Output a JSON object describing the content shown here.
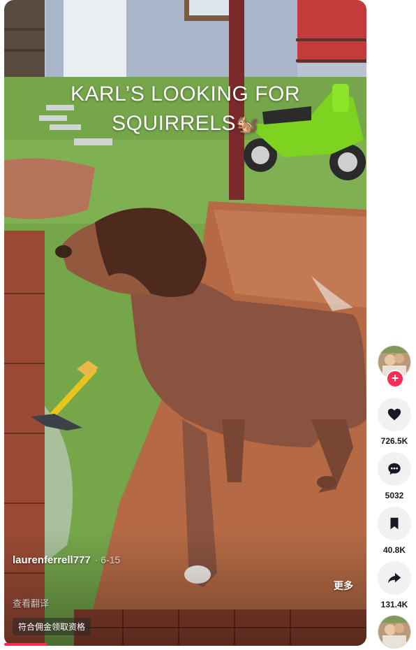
{
  "video": {
    "caption_line1": "KARL’S LOOKING FOR",
    "caption_line2": "SQUIRRELS",
    "caption_emoji": "🐿️",
    "username": "laurenferrell777",
    "date": "· 6-15",
    "more_label": "更多",
    "translate_label": "查看翻译",
    "promo_label": "符合佣金领取资格",
    "progress_fraction": 0.12,
    "progress_color": "#fe2c55"
  },
  "sidebar": {
    "follow_symbol": "+",
    "like": {
      "icon": "heart-icon",
      "count": "726.5K"
    },
    "comment": {
      "icon": "comment-bubble-icon",
      "count": "5032"
    },
    "favorite": {
      "icon": "bookmark-icon",
      "count": "40.8K"
    },
    "share": {
      "icon": "share-arrow-icon",
      "count": "131.4K"
    }
  },
  "colors": {
    "accent": "#fe2c55",
    "button_bg": "#f1f1f2",
    "count_text": "#161823"
  }
}
